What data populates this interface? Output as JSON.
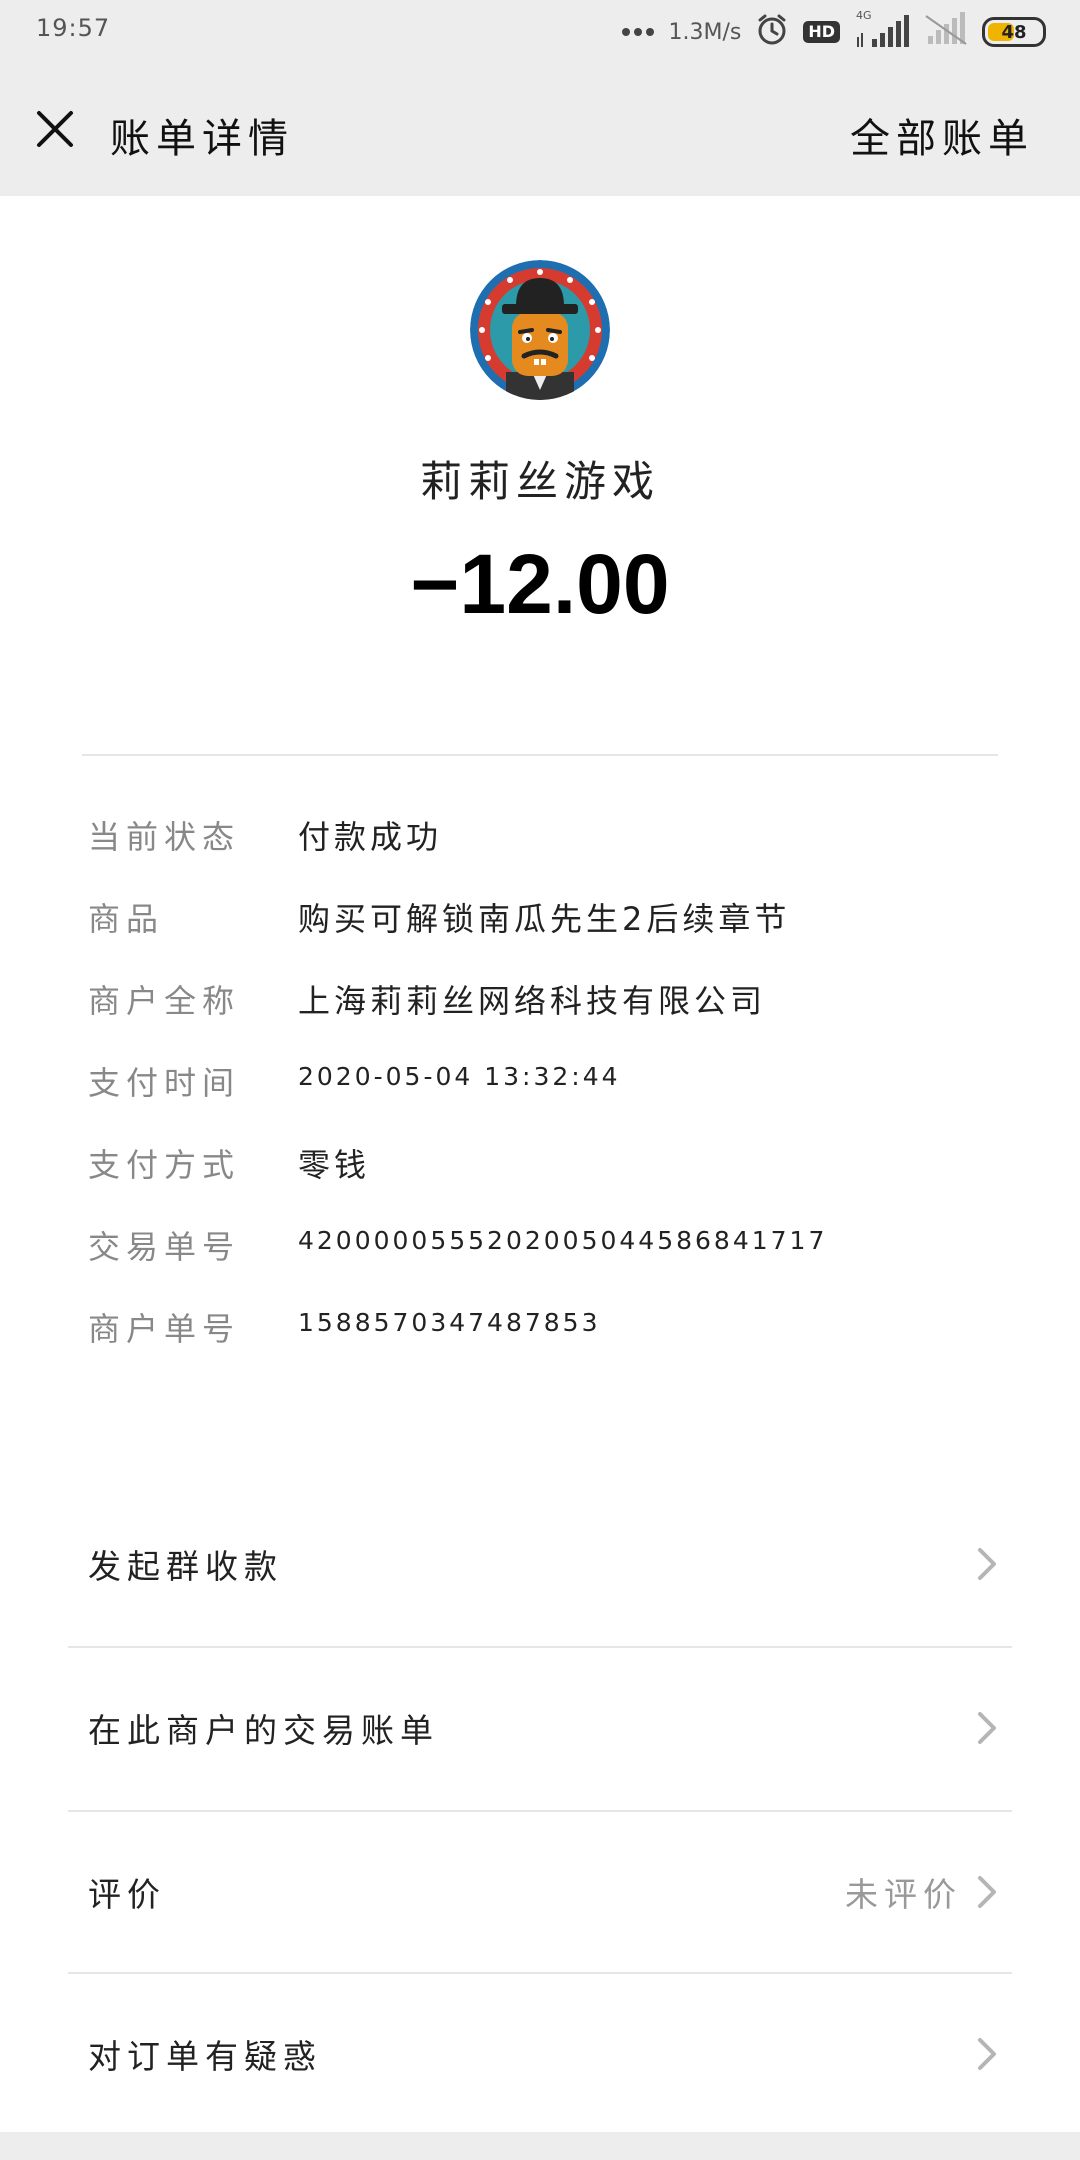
{
  "status_bar": {
    "time": "19:57",
    "net_speed": "1.3M/s",
    "hd_label": "HD",
    "network_type": "4G",
    "battery": "48"
  },
  "nav": {
    "title": "账单详情",
    "right_action": "全部账单"
  },
  "merchant": {
    "name": "莉莉丝游戏",
    "amount": "−12.00",
    "avatar_icon": "cartoon-pumpkin-man-avatar"
  },
  "details": [
    {
      "label": "当前状态",
      "value": "付款成功"
    },
    {
      "label": "商品",
      "value": "购买可解锁南瓜先生2后续章节"
    },
    {
      "label": "商户全称",
      "value": "上海莉莉丝网络科技有限公司"
    },
    {
      "label": "支付时间",
      "value": "2020-05-04  13:32:44"
    },
    {
      "label": "支付方式",
      "value": "零钱"
    },
    {
      "label": "交易单号",
      "value": "4200000555202005044586841717"
    },
    {
      "label": "商户单号",
      "value": "1588570347487853"
    }
  ],
  "actions": [
    {
      "label": "发起群收款",
      "extra": ""
    },
    {
      "label": "在此商户的交易账单",
      "extra": ""
    },
    {
      "label": "评价",
      "extra": "未评价"
    },
    {
      "label": "对订单有疑惑",
      "extra": ""
    }
  ],
  "colors": {
    "background": "#ededed",
    "card": "#ffffff",
    "label_gray": "#888888",
    "battery_fill": "#f0b400"
  }
}
